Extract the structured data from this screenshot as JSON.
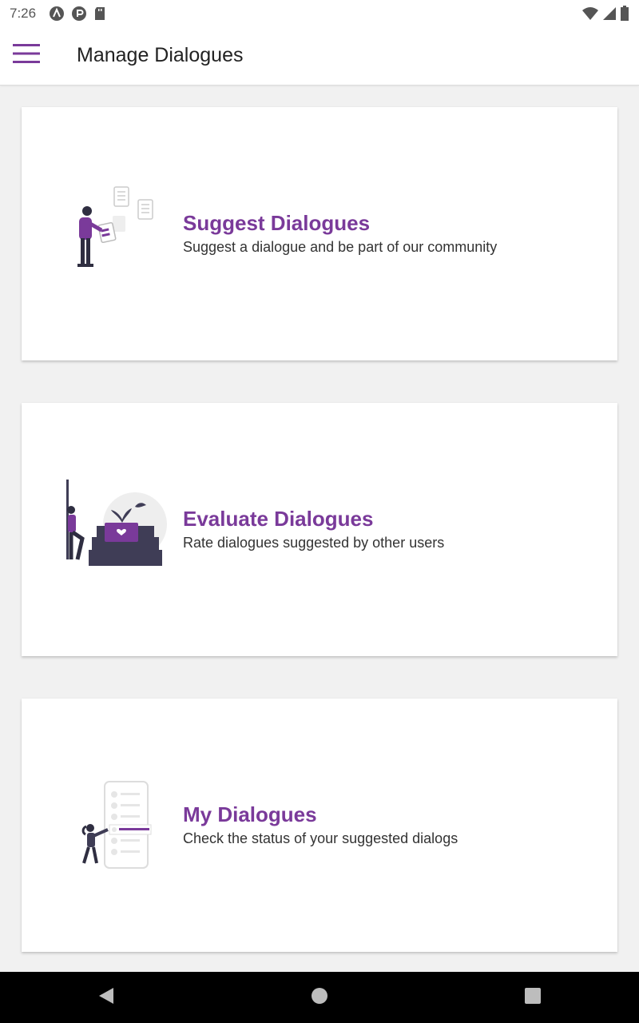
{
  "status_bar": {
    "time": "7:26",
    "icons": [
      "notification-a-icon",
      "notification-p-icon",
      "sd-card-icon"
    ],
    "right_icons": [
      "wifi-icon",
      "signal-icon",
      "battery-icon"
    ]
  },
  "app_bar": {
    "menu_icon": "menu-icon",
    "title": "Manage Dialogues"
  },
  "cards": [
    {
      "title": "Suggest Dialogues",
      "subtitle": "Suggest a dialogue and be part of our community",
      "illustration": "suggest-illustration"
    },
    {
      "title": "Evaluate Dialogues",
      "subtitle": "Rate dialogues suggested by other users",
      "illustration": "evaluate-illustration"
    },
    {
      "title": "My Dialogues",
      "subtitle": "Check the status of your suggested dialogs",
      "illustration": "my-dialogues-illustration"
    }
  ],
  "nav_bar": {
    "back": "back-icon",
    "home": "home-icon",
    "recents": "recents-icon"
  },
  "colors": {
    "accent": "#7a3a9a",
    "background": "#f1f1f1",
    "card": "#ffffff",
    "nav": "#000000"
  }
}
